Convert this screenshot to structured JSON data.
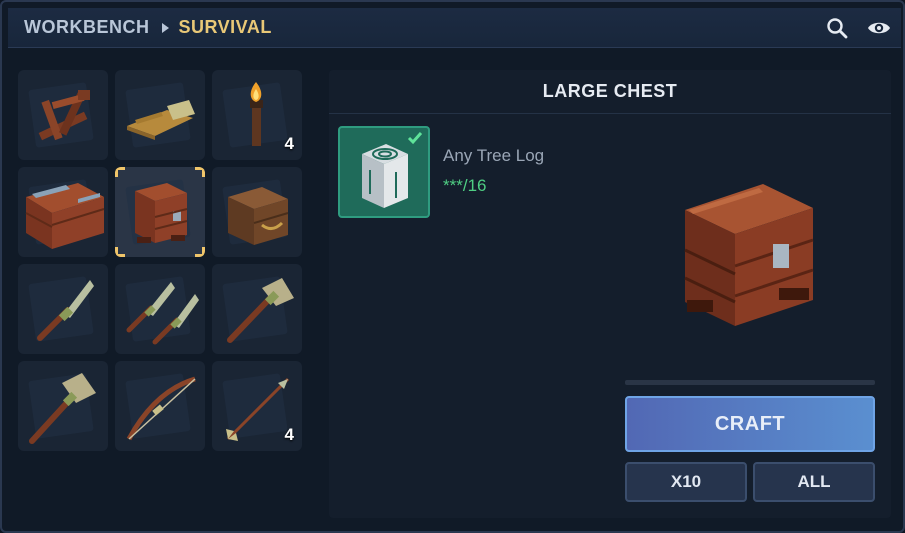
{
  "header": {
    "breadcrumb_root": "WORKBENCH",
    "breadcrumb_current": "SURVIVAL",
    "icons": [
      "search-icon",
      "eye-icon"
    ]
  },
  "grid": {
    "items": [
      {
        "name": "catapult",
        "quantity": ""
      },
      {
        "name": "bedroll",
        "quantity": ""
      },
      {
        "name": "torch",
        "quantity": "4"
      },
      {
        "name": "wide-chest",
        "quantity": ""
      },
      {
        "name": "large-chest",
        "quantity": "",
        "selected": true
      },
      {
        "name": "small-chest",
        "quantity": ""
      },
      {
        "name": "stone-knife",
        "quantity": ""
      },
      {
        "name": "dual-stone-knives",
        "quantity": ""
      },
      {
        "name": "stone-axe",
        "quantity": ""
      },
      {
        "name": "stone-hammer",
        "quantity": ""
      },
      {
        "name": "wooden-bow",
        "quantity": ""
      },
      {
        "name": "arrow",
        "quantity": "4"
      }
    ]
  },
  "detail": {
    "title": "LARGE CHEST",
    "ingredient": {
      "name": "Any Tree Log",
      "count": "***/16",
      "icon": "tree-log-icon",
      "satisfied": true
    },
    "craft_progress": 0,
    "buttons": {
      "craft": "CRAFT",
      "x10": "X10",
      "all": "ALL"
    }
  },
  "colors": {
    "accent_gold": "#e9c877",
    "craft_blue": "#5a8fd0",
    "ingredient_green": "#1f6b5a",
    "count_green": "#4fce83"
  }
}
